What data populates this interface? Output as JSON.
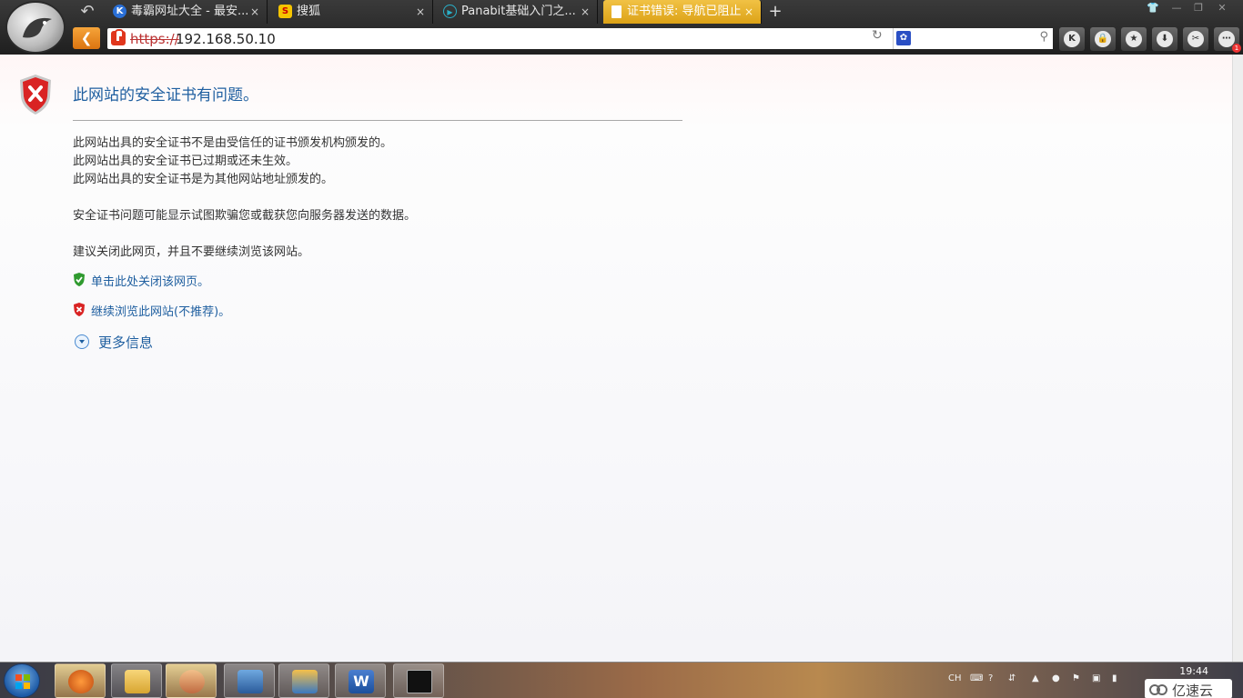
{
  "browser": {
    "tabs": [
      {
        "title": "毒霸网址大全 - 最安...",
        "icon": "K"
      },
      {
        "title": "搜狐",
        "icon": "S"
      },
      {
        "title": "Panabit基础入门之...",
        "icon": "▶"
      },
      {
        "title": "证书错误: 导航已阻止",
        "icon": "",
        "active": true
      }
    ],
    "close_glyph": "×",
    "new_tab_glyph": "+",
    "address": {
      "scheme": "https://",
      "host": "192.168.50.10"
    },
    "search_engine_icon": "paw-icon",
    "toolbar_buttons": [
      "K",
      "🔒",
      "★",
      "⬇",
      "✂",
      "⋯"
    ],
    "notification_count": "1"
  },
  "page": {
    "title": "此网站的安全证书有问题。",
    "reasons": [
      "此网站出具的安全证书不是由受信任的证书颁发机构颁发的。",
      "此网站出具的安全证书已过期或还未生效。",
      "此网站出具的安全证书是为其他网站地址颁发的。"
    ],
    "warning": "安全证书问题可能显示试图欺骗您或截获您向服务器发送的数据。",
    "recommendation": "建议关闭此网页，并且不要继续浏览该网站。",
    "close_link": "单击此处关闭该网页。",
    "continue_link": "继续浏览此网站(不推荐)。",
    "more_info": "更多信息"
  },
  "taskbar": {
    "tray_lang": "CH",
    "clock_time": "19:44",
    "watermark_text": "亿速云"
  },
  "colors": {
    "link": "#1f5fa0",
    "active_tab": "#dca216",
    "error_red": "#e0361d"
  }
}
